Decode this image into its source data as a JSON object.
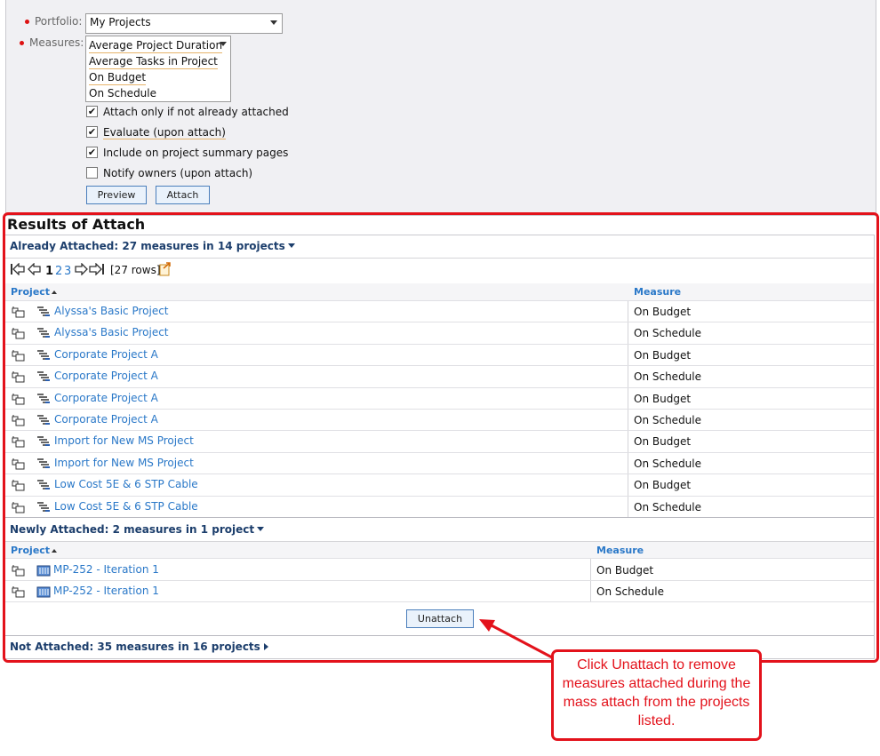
{
  "form": {
    "portfolio_label": "Portfolio:",
    "portfolio_value": "My Projects",
    "measures_label": "Measures:",
    "measures": [
      "Average Project Duration",
      "Average Tasks in Project",
      "On Budget",
      "On Schedule"
    ],
    "checkboxes": [
      {
        "label": "Attach only if not already attached",
        "checked": "✔"
      },
      {
        "label": "Evaluate (upon attach)",
        "checked": "✔"
      },
      {
        "label": "Include on project summary pages",
        "checked": "✔"
      },
      {
        "label": "Notify owners (upon attach)",
        "checked": ""
      }
    ],
    "preview_button": "Preview",
    "attach_button": "Attach"
  },
  "results": {
    "title": "Results of Attach",
    "already": {
      "header": "Already Attached: 27 measures in 14 projects",
      "pager": {
        "pages": [
          "1",
          "2",
          "3"
        ],
        "rows": "[27 rows]"
      },
      "col_project": "Project",
      "col_measure": "Measure",
      "rows": [
        {
          "project": "Alyssa's Basic Project",
          "measure": "On Budget"
        },
        {
          "project": "Alyssa's Basic Project",
          "measure": "On Schedule"
        },
        {
          "project": "Corporate Project A",
          "measure": "On Budget"
        },
        {
          "project": "Corporate Project A",
          "measure": "On Schedule"
        },
        {
          "project": "Corporate Project A",
          "measure": "On Budget"
        },
        {
          "project": "Corporate Project A",
          "measure": "On Schedule"
        },
        {
          "project": "Import for New MS Project",
          "measure": "On Budget"
        },
        {
          "project": "Import for New MS Project",
          "measure": "On Schedule"
        },
        {
          "project": "Low Cost 5E & 6 STP Cable",
          "measure": "On Budget"
        },
        {
          "project": "Low Cost 5E & 6 STP Cable",
          "measure": "On Schedule"
        }
      ]
    },
    "newly": {
      "header": "Newly Attached: 2 measures in 1 project",
      "col_project": "Project",
      "col_measure": "Measure",
      "rows": [
        {
          "project": "MP-252 - Iteration 1",
          "measure": "On Budget"
        },
        {
          "project": "MP-252 - Iteration 1",
          "measure": "On Schedule"
        }
      ],
      "unattach_button": "Unattach"
    },
    "not_attached": {
      "header": "Not Attached: 35 measures in 16 projects"
    }
  },
  "callout": {
    "text": "Click Unattach to remove measures attached during the mass attach from the projects listed."
  },
  "colors": {
    "accent_red": "#e3121b",
    "link_blue": "#2a78c8",
    "header_navy": "#1c3e6c"
  }
}
